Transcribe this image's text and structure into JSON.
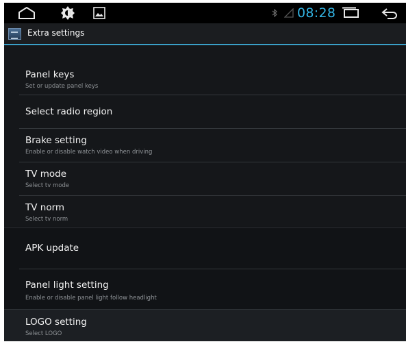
{
  "status_bar": {
    "time": "08:28",
    "icons": [
      "home-icon",
      "brightness-icon",
      "gallery-icon",
      "bluetooth-icon",
      "signal-icon",
      "recent-apps-icon",
      "back-icon"
    ],
    "accent": "#33b5e5"
  },
  "action_bar": {
    "title": "Extra settings",
    "accent": "#3aa0c8"
  },
  "settings": [
    {
      "title": "Panel keys",
      "subtitle": "Set or update panel keys"
    },
    {
      "title": "Select radio region",
      "subtitle": ""
    },
    {
      "title": "Brake setting",
      "subtitle": "Enable or disable watch video when driving"
    },
    {
      "title": "TV mode",
      "subtitle": "Select tv mode"
    },
    {
      "title": "TV norm",
      "subtitle": "Select tv norm"
    },
    {
      "title": "APK update",
      "subtitle": ""
    },
    {
      "title": "Panel light setting",
      "subtitle": "Enable or disable panel light follow headlight"
    },
    {
      "title": "LOGO setting",
      "subtitle": "Select LOGO"
    }
  ]
}
